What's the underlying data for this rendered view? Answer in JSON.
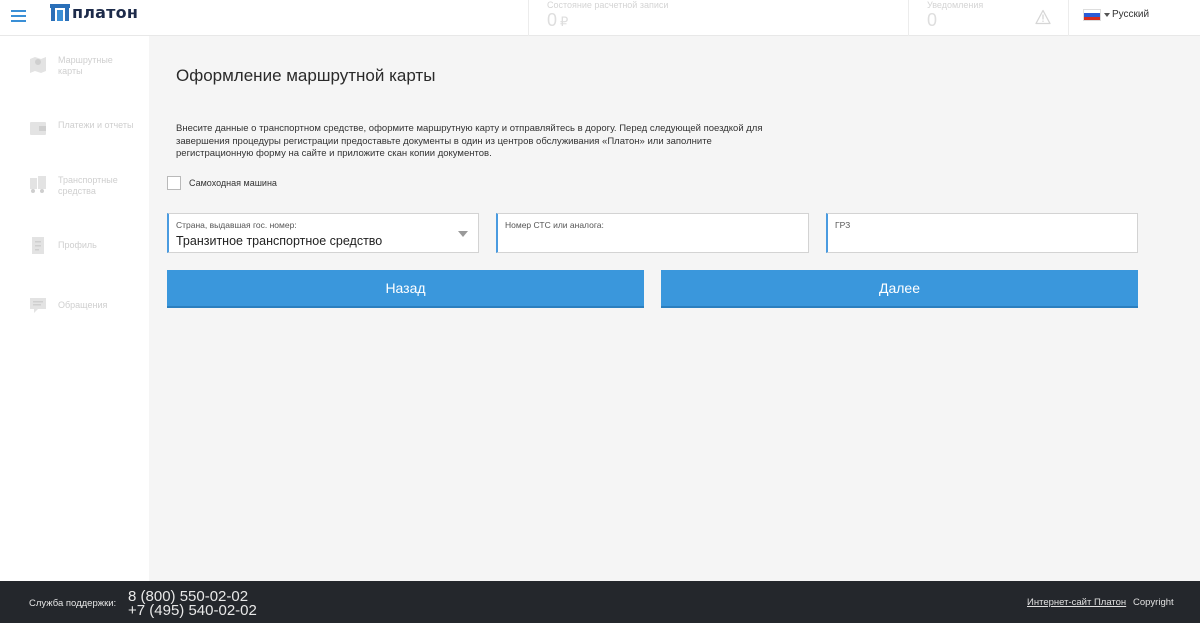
{
  "header": {
    "brand": "платон",
    "account_label": "Состояние расчетной записи",
    "account_value": "0",
    "account_currency": "₽",
    "notifications_label": "Уведомления",
    "notifications_value": "0",
    "language": "Русский",
    "icons": {
      "menu": "hamburger-menu-icon",
      "warning": "warning-triangle-icon",
      "flag": "russia-flag-icon",
      "language_caret": "caret-down-icon"
    }
  },
  "sidebar": {
    "items": [
      {
        "label": "Маршрутные карты",
        "icon": "map-icon"
      },
      {
        "label": "Платежи и отчеты",
        "icon": "wallet-icon"
      },
      {
        "label": "Транспортные средства",
        "icon": "truck-icon"
      },
      {
        "label": "Профиль",
        "icon": "profile-document-icon"
      },
      {
        "label": "Обращения",
        "icon": "chat-bubble-icon"
      }
    ]
  },
  "main": {
    "title": "Оформление маршрутной карты",
    "intro": "Внесите данные о транспортном средстве, оформите маршрутную карту и отправляйтесь в дорогу. Перед следующей поездкой для завершения процедуры регистрации предоставьте документы в один из центров обслуживания «Платон» или заполните регистрационную форму на сайте и приложите скан копии документов.",
    "self_propelled_label": "Самоходная машина",
    "self_propelled_checked": false,
    "fields": {
      "country": {
        "label": "Страна, выдавшая гос. номер:",
        "value": "Транзитное транспортное средство"
      },
      "sts": {
        "label": "Номер СТС или аналога:",
        "value": ""
      },
      "grz": {
        "label": "ГРЗ",
        "value": ""
      }
    },
    "back_button": "Назад",
    "next_button": "Далее"
  },
  "footer": {
    "support_label": "Служба поддержки:",
    "phone1": "8 (800) 550-02-02",
    "phone2": "+7 (495) 540-02-02",
    "site_link": "Интернет-сайт Платон",
    "copyright": "Copyright"
  },
  "colors": {
    "accent": "#3a97dc",
    "footer_bg": "#24272c",
    "sidebar_text": "#cfcfcf"
  }
}
